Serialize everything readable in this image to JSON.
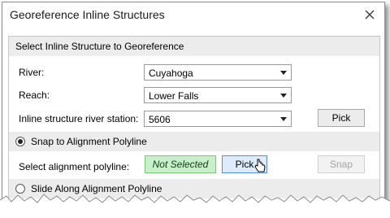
{
  "window": {
    "title": "Georeference Inline Structures"
  },
  "section1": {
    "header": "Select Inline Structure to Georeference"
  },
  "fields": {
    "river": {
      "label": "River:",
      "value": "Cuyahoga"
    },
    "reach": {
      "label": "Reach:",
      "value": "Lower Falls"
    },
    "station": {
      "label": "Inline structure river station:",
      "value": "5606"
    }
  },
  "buttons": {
    "pick_station": "Pick",
    "pick_polyline": "Pick",
    "snap": "Snap"
  },
  "snap_option": {
    "label": "Snap to Alignment Polyline",
    "selected": true
  },
  "polyline": {
    "label": "Select alignment polyline:",
    "status": "Not Selected"
  },
  "slide_option": {
    "label": "Slide Along Alignment Polyline",
    "selected": false
  },
  "colors": {
    "accent": "#5a8fd0",
    "status_bg": "#c8f0c8",
    "header_bg": "#ececec"
  }
}
